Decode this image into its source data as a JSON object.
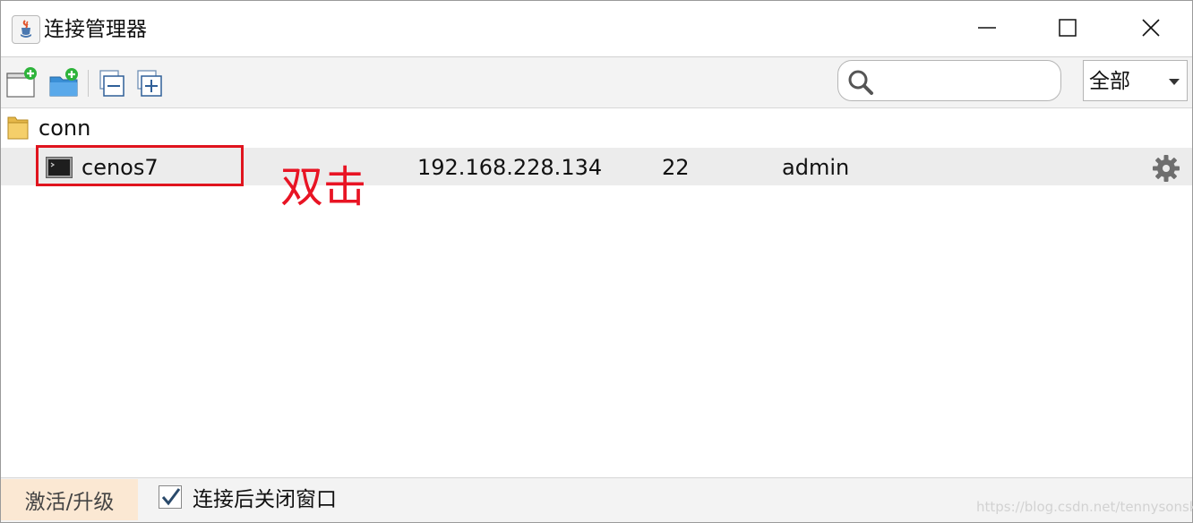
{
  "window": {
    "title": "连接管理器",
    "app_icon": "java-cup-icon",
    "controls": [
      "minimize-icon",
      "maximize-icon",
      "close-icon"
    ]
  },
  "toolbar": {
    "buttons": [
      "new-session-icon",
      "new-folder-icon",
      "collapse-all-icon",
      "expand-all-icon"
    ],
    "search": {
      "value": "",
      "placeholder": ""
    },
    "filter": {
      "selected": "全部"
    }
  },
  "tree": {
    "folder": {
      "label": "conn",
      "icon": "folder-icon"
    },
    "connections": [
      {
        "name": "cenos7",
        "host": "192.168.228.134",
        "port": "22",
        "user": "admin",
        "icon": "terminal-icon"
      }
    ]
  },
  "annotation": {
    "text": "双击",
    "color": "#e81424"
  },
  "statusbar": {
    "upgrade_label": "激活/升级",
    "close_after_connect_label": "连接后关闭窗口",
    "close_after_connect_checked": true
  },
  "watermark": "https://blog.csdn.net/tennysonsky"
}
